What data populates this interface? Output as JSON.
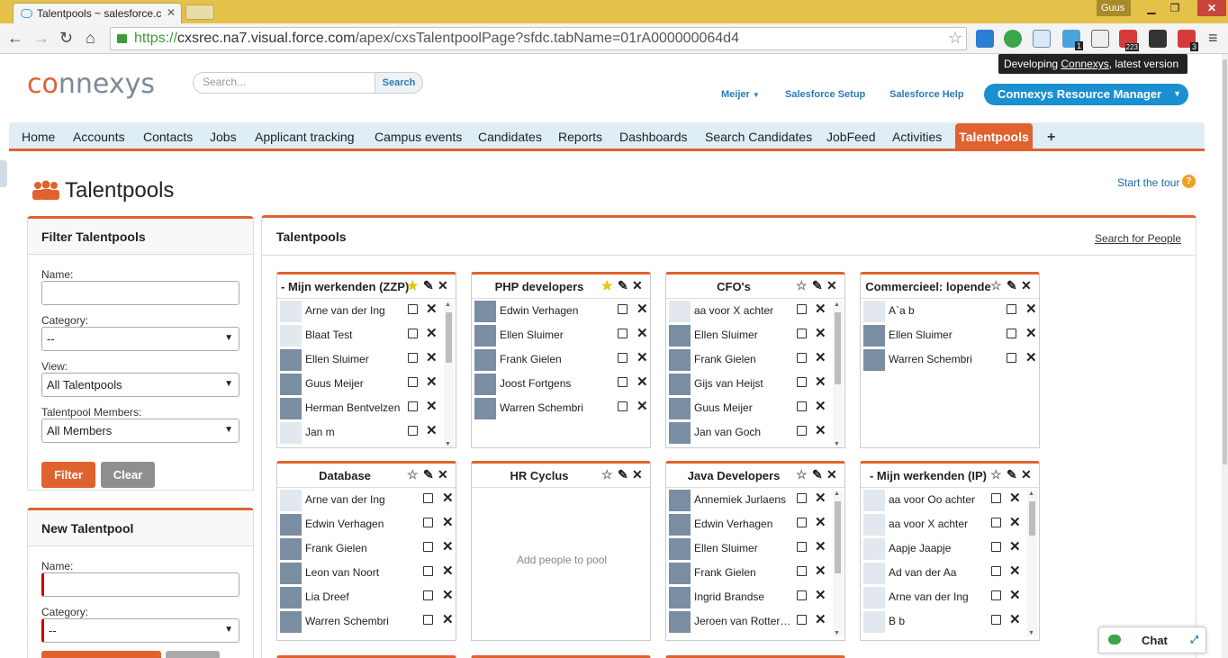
{
  "browser": {
    "tab_title": "Talentpools ~ salesforce.c",
    "user": "Guus",
    "url_scheme": "https://",
    "url_host": "cxsrec.na7.visual.force.com",
    "url_path": "/apex/cxsTalentpoolPage?sfdc.tabName=01rA000000064d4",
    "ext_badges": [
      "1",
      "223",
      "3"
    ]
  },
  "header": {
    "logo_a": "co",
    "logo_b": "nnexys",
    "search_placeholder": "Search...",
    "search_button": "Search",
    "tooltip_prefix": "Developing ",
    "tooltip_link": "Connexys",
    "tooltip_suffix": ", latest version",
    "user_menu": "Meijer",
    "setup_link": "Salesforce Setup",
    "help_link": "Salesforce Help",
    "app_button": "Connexys Resource Manager"
  },
  "nav": {
    "tabs": [
      "Home",
      "Accounts",
      "Contacts",
      "Jobs",
      "Applicant tracking",
      "Campus events",
      "Candidates",
      "Reports",
      "Dashboards",
      "Search Candidates",
      "JobFeed",
      "Activities"
    ],
    "active": "Talentpools",
    "plus": "+"
  },
  "page": {
    "title": "Talentpools",
    "tour": "Start the tour",
    "tour_icon": "?"
  },
  "filter": {
    "title": "Filter Talentpools",
    "name_label": "Name:",
    "category_label": "Category:",
    "category_value": "--",
    "view_label": "View:",
    "view_value": "All Talentpools",
    "members_label": "Talentpool Members:",
    "members_value": "All Members",
    "filter_btn": "Filter",
    "clear_btn": "Clear"
  },
  "newpool": {
    "title": "New Talentpool",
    "name_label": "Name:",
    "category_label": "Category:",
    "category_value": "--"
  },
  "main": {
    "title": "Talentpools",
    "search_people": "Search for People",
    "empty_text": "Add people to pool",
    "pools": [
      {
        "title": "- Mijn werkenden (ZZP)",
        "fav": true,
        "scroll": true,
        "members": [
          {
            "name": "Arne van der Ing",
            "photo": false
          },
          {
            "name": "Blaat Test",
            "photo": false
          },
          {
            "name": "Ellen Sluimer",
            "photo": true
          },
          {
            "name": "Guus Meijer",
            "photo": true
          },
          {
            "name": "Herman Bentvelzen",
            "photo": true
          },
          {
            "name": "Jan m",
            "photo": false
          }
        ]
      },
      {
        "title": "PHP developers",
        "fav": true,
        "scroll": false,
        "members": [
          {
            "name": "Edwin Verhagen",
            "photo": true
          },
          {
            "name": "Ellen Sluimer",
            "photo": true
          },
          {
            "name": "Frank Gielen",
            "photo": true
          },
          {
            "name": "Joost Fortgens",
            "photo": true
          },
          {
            "name": "Warren Schembri",
            "photo": true
          }
        ]
      },
      {
        "title": "CFO's",
        "fav": false,
        "scroll": true,
        "members": [
          {
            "name": "aa voor X achter",
            "photo": false
          },
          {
            "name": "Ellen Sluimer",
            "photo": true
          },
          {
            "name": "Frank Gielen",
            "photo": true
          },
          {
            "name": "Gijs van Heijst",
            "photo": true
          },
          {
            "name": "Guus Meijer",
            "photo": true
          },
          {
            "name": "Jan van Goch",
            "photo": true
          }
        ]
      },
      {
        "title": "Commercieel: lopende",
        "fav": false,
        "scroll": false,
        "members": [
          {
            "name": "A`a b",
            "photo": false
          },
          {
            "name": "Ellen Sluimer",
            "photo": true
          },
          {
            "name": "Warren Schembri",
            "photo": true
          }
        ]
      },
      {
        "title": "Database",
        "fav": false,
        "scroll": false,
        "members": [
          {
            "name": "Arne van der Ing",
            "photo": false
          },
          {
            "name": "Edwin Verhagen",
            "photo": true
          },
          {
            "name": "Frank Gielen",
            "photo": true
          },
          {
            "name": "Leon van Noort",
            "photo": true
          },
          {
            "name": "Lia Dreef",
            "photo": true
          },
          {
            "name": "Warren Schembri",
            "photo": true
          }
        ]
      },
      {
        "title": "HR Cyclus",
        "fav": false,
        "scroll": false,
        "members": []
      },
      {
        "title": "Java Developers",
        "fav": false,
        "scroll": true,
        "members": [
          {
            "name": "Annemiek Jurlaens",
            "photo": true
          },
          {
            "name": "Edwin Verhagen",
            "photo": true
          },
          {
            "name": "Ellen Sluimer",
            "photo": true
          },
          {
            "name": "Frank Gielen",
            "photo": true
          },
          {
            "name": "Ingrid Brandse",
            "photo": true
          },
          {
            "name": "Jeroen van Rotter…",
            "photo": true
          }
        ]
      },
      {
        "title": "- Mijn werkenden (IP)",
        "fav": false,
        "scroll": true,
        "members": [
          {
            "name": "aa voor Oo achter",
            "photo": false
          },
          {
            "name": "aa voor X achter",
            "photo": false
          },
          {
            "name": "Aapje Jaapje",
            "photo": false
          },
          {
            "name": "Ad van der Aa",
            "photo": false
          },
          {
            "name": "Arne van der Ing",
            "photo": false
          },
          {
            "name": "B b",
            "photo": false
          }
        ]
      }
    ]
  },
  "chat": {
    "label": "Chat"
  },
  "colors": {
    "accent": "#e0622e",
    "brand_blue": "#1a90d1",
    "tab_bar": "#dfeef6"
  }
}
